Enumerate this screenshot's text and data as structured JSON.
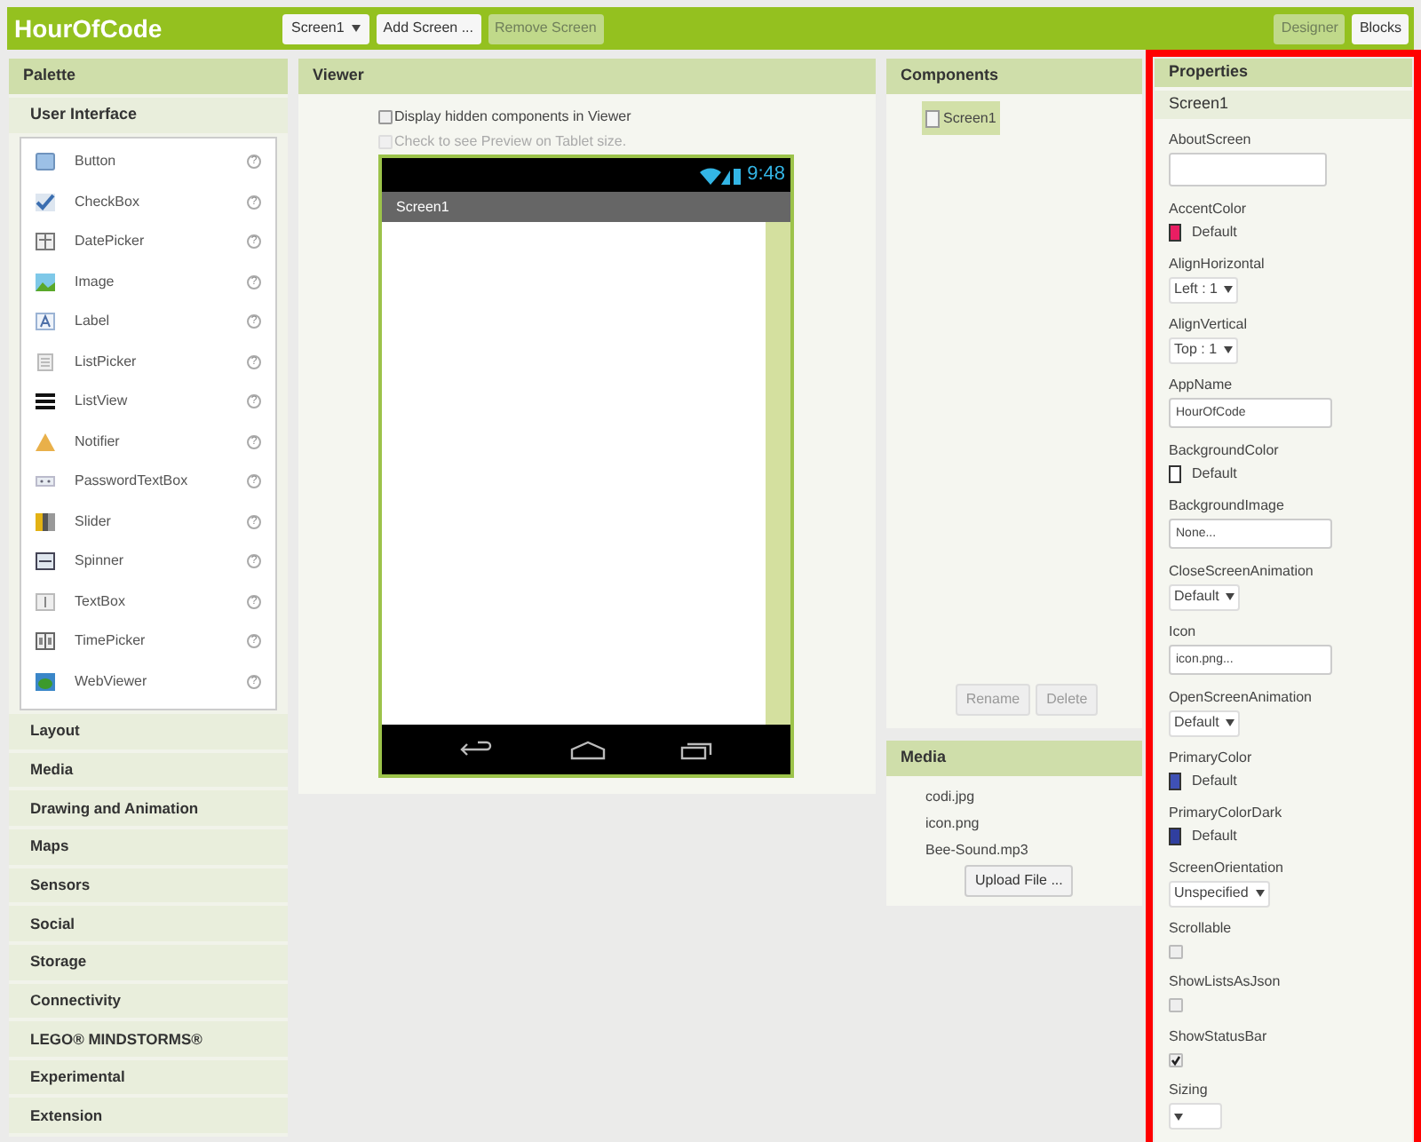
{
  "app": {
    "title": "HourOfCode"
  },
  "toolbar": {
    "screen_menu": "Screen1",
    "buttons": [
      {
        "label": "Add Screen ...",
        "disabled": false
      },
      {
        "label": "Remove Screen",
        "disabled": true
      }
    ],
    "views": [
      {
        "label": "Designer",
        "selected": true
      },
      {
        "label": "Blocks",
        "selected": false
      }
    ]
  },
  "palette": {
    "title": "Palette",
    "open_category": "User Interface",
    "items": [
      {
        "label": "Button",
        "help": "?"
      },
      {
        "label": "CheckBox",
        "help": "?"
      },
      {
        "label": "DatePicker",
        "help": "?"
      },
      {
        "label": "Image",
        "help": "?"
      },
      {
        "label": "Label",
        "help": "?"
      },
      {
        "label": "ListPicker",
        "help": "?"
      },
      {
        "label": "ListView",
        "help": "?"
      },
      {
        "label": "Notifier",
        "help": "?"
      },
      {
        "label": "PasswordTextBox",
        "help": "?"
      },
      {
        "label": "Slider",
        "help": "?"
      },
      {
        "label": "Spinner",
        "help": "?"
      },
      {
        "label": "TextBox",
        "help": "?"
      },
      {
        "label": "TimePicker",
        "help": "?"
      },
      {
        "label": "WebViewer",
        "help": "?"
      }
    ],
    "categories": [
      "Layout",
      "Media",
      "Drawing and Animation",
      "Maps",
      "Sensors",
      "Social",
      "Storage",
      "Connectivity",
      "LEGO® MINDSTORMS®",
      "Experimental",
      "Extension"
    ]
  },
  "viewer": {
    "title": "Viewer",
    "options": [
      {
        "label": "Display hidden components in Viewer",
        "checked": false,
        "disabled": false
      },
      {
        "label": "Check to see Preview on Tablet size.",
        "checked": false,
        "disabled": true
      }
    ],
    "phone": {
      "time": "9:48",
      "screen_title": "Screen1"
    }
  },
  "components": {
    "title": "Components",
    "tree": [
      {
        "label": "Screen1",
        "selected": true
      }
    ],
    "buttons": [
      {
        "label": "Rename",
        "disabled": true
      },
      {
        "label": "Delete",
        "disabled": true
      }
    ]
  },
  "media": {
    "title": "Media",
    "files": [
      "codi.jpg",
      "icon.png",
      "Bee-Sound.mp3"
    ],
    "upload_button": "Upload File ..."
  },
  "properties": {
    "title": "Properties",
    "component": "Screen1",
    "items": [
      {
        "name": "AboutScreen",
        "kind": "textarea"
      },
      {
        "name": "AccentColor",
        "kind": "color",
        "color": "#e91e63",
        "value": "Default"
      },
      {
        "name": "AlignHorizontal",
        "kind": "dropdown",
        "value": "Left : 1"
      },
      {
        "name": "AlignVertical",
        "kind": "dropdown",
        "value": "Top : 1"
      },
      {
        "name": "AppName",
        "kind": "text",
        "value": "HourOfCode"
      },
      {
        "name": "BackgroundColor",
        "kind": "color",
        "color": "#ffffff",
        "value": "Default"
      },
      {
        "name": "BackgroundImage",
        "kind": "text",
        "value": "None..."
      },
      {
        "name": "CloseScreenAnimation",
        "kind": "dropdown",
        "value": "Default"
      },
      {
        "name": "Icon",
        "kind": "text",
        "value": "icon.png..."
      },
      {
        "name": "OpenScreenAnimation",
        "kind": "dropdown",
        "value": "Default"
      },
      {
        "name": "PrimaryColor",
        "kind": "color",
        "color": "#3f51b5",
        "value": "Default"
      },
      {
        "name": "PrimaryColorDark",
        "kind": "color",
        "color": "#303f9f",
        "value": "Default"
      },
      {
        "name": "ScreenOrientation",
        "kind": "dropdown",
        "value": "Unspecified"
      },
      {
        "name": "Scrollable",
        "kind": "checkbox",
        "checked": false
      },
      {
        "name": "ShowListsAsJson",
        "kind": "checkbox",
        "checked": false
      },
      {
        "name": "ShowStatusBar",
        "kind": "checkbox",
        "checked": true
      },
      {
        "name": "Sizing",
        "kind": "dropdown"
      }
    ]
  }
}
